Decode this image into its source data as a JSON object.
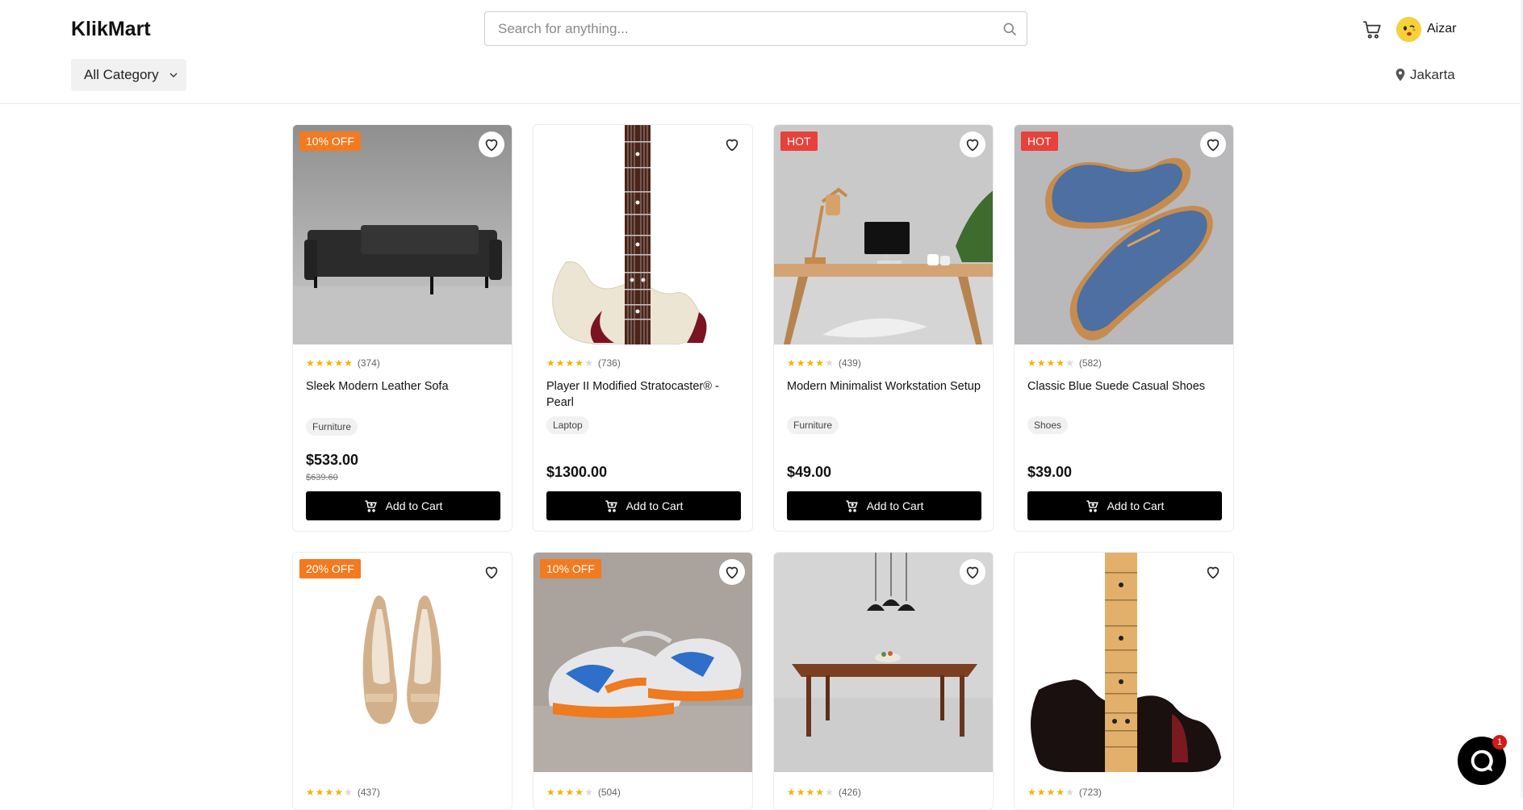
{
  "header": {
    "logo": "KlikMart",
    "search_placeholder": "Search for anything...",
    "user_name": "Aizar",
    "category_label": "All Category",
    "location": "Jakarta"
  },
  "add_to_cart_label": "Add to Cart",
  "products": [
    {
      "badge": "10% OFF",
      "badge_type": "off",
      "rating": 4.5,
      "reviews": "(374)",
      "title": "Sleek Modern Leather Sofa",
      "tag": "Furniture",
      "price": "$533.00",
      "old_price": "$639.60"
    },
    {
      "badge": "",
      "badge_type": "",
      "rating": 3.5,
      "reviews": "(736)",
      "title": "Player II Modified Stratocaster® - Pearl",
      "tag": "Laptop",
      "price": "$1300.00",
      "old_price": ""
    },
    {
      "badge": "HOT",
      "badge_type": "hot",
      "rating": 4,
      "reviews": "(439)",
      "title": "Modern Minimalist Workstation Setup",
      "tag": "Furniture",
      "price": "$49.00",
      "old_price": ""
    },
    {
      "badge": "HOT",
      "badge_type": "hot",
      "rating": 4,
      "reviews": "(582)",
      "title": "Classic Blue Suede Casual Shoes",
      "tag": "Shoes",
      "price": "$39.00",
      "old_price": ""
    },
    {
      "badge": "20% OFF",
      "badge_type": "off",
      "rating": 4,
      "reviews": "(437)",
      "title": "",
      "tag": "",
      "price": "",
      "old_price": ""
    },
    {
      "badge": "10% OFF",
      "badge_type": "off",
      "rating": 3.5,
      "reviews": "(504)",
      "title": "",
      "tag": "",
      "price": "",
      "old_price": ""
    },
    {
      "badge": "",
      "badge_type": "",
      "rating": 3.5,
      "reviews": "(426)",
      "title": "",
      "tag": "",
      "price": "",
      "old_price": ""
    },
    {
      "badge": "",
      "badge_type": "",
      "rating": 3.5,
      "reviews": "(723)",
      "title": "",
      "tag": "",
      "price": "",
      "old_price": ""
    }
  ],
  "chat": {
    "unread": "1"
  },
  "colors": {
    "accent": "#000000",
    "badge_off": "#f47a20",
    "badge_hot": "#e7413b",
    "star": "#f5b301"
  }
}
